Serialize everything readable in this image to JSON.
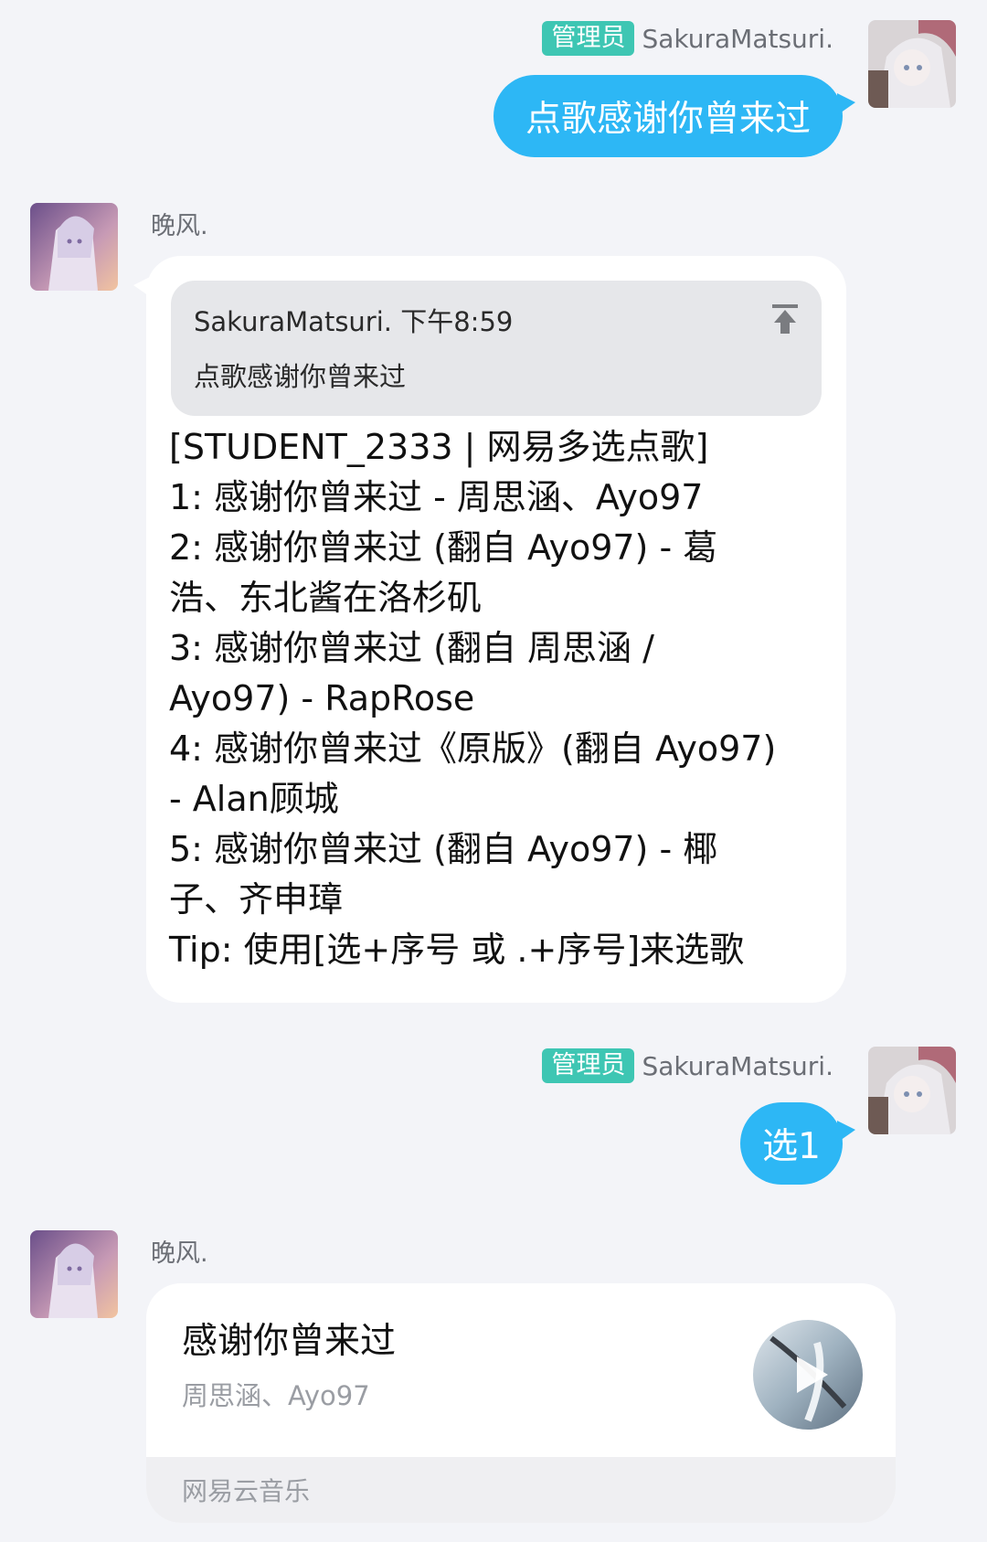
{
  "messages": [
    {
      "sender_badge": "管理员",
      "sender_name": "SakuraMatsuri.",
      "text": "点歌感谢你曾来过"
    },
    {
      "sender_name": "晚风.",
      "quote": {
        "header": "SakuraMatsuri. 下午8:59",
        "body": "点歌感谢你曾来过",
        "icon": "pin-top-icon"
      },
      "lines": [
        "[STUDENT_2333 | 网易多选点歌]",
        "1: 感谢你曾来过 - 周思涵、Ayo97",
        "2: 感谢你曾来过 (翻自 Ayo97) - 葛",
        "浩、东北酱在洛杉矶",
        "3: 感谢你曾来过 (翻自 周思涵 /",
        "Ayo97) - RapRose",
        "4: 感谢你曾来过《原版》(翻自 Ayo97)",
        "- Alan顾城",
        "5: 感谢你曾来过 (翻自 Ayo97)  - 椰",
        "子、齐申璋",
        "Tip: 使用[选+序号 或 .+序号]来选歌"
      ]
    },
    {
      "sender_badge": "管理员",
      "sender_name": "SakuraMatsuri.",
      "text": "选1"
    },
    {
      "sender_name": "晚风.",
      "music_card": {
        "title": "感谢你曾来过",
        "artist": "周思涵、Ayo97",
        "source": "网易云音乐",
        "cover_icon": "play-icon"
      }
    }
  ],
  "colors": {
    "background": "#f3f4f8",
    "self_bubble": "#2db7f5",
    "admin_badge": "#3ec6b3"
  }
}
